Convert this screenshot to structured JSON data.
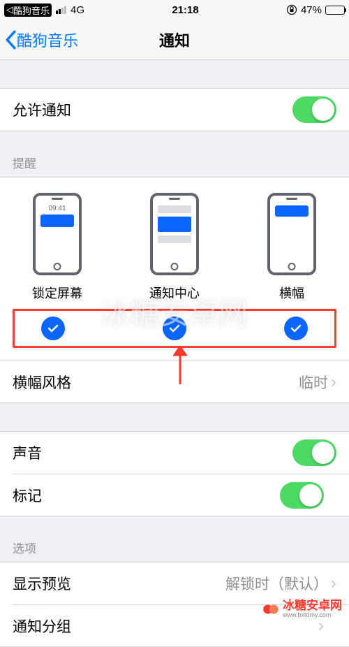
{
  "status": {
    "app_back": "酷狗音乐",
    "carrier_mode": "4G",
    "time": "21:18",
    "battery_pct": "47%"
  },
  "nav": {
    "back": "酷狗音乐",
    "title": "通知"
  },
  "allow": {
    "label": "允许通知",
    "enabled": true
  },
  "alerts": {
    "header": "提醒",
    "lock_label": "锁定屏幕",
    "lock_time": "09:41",
    "center_label": "通知中心",
    "banner_label": "横幅",
    "lock_checked": true,
    "center_checked": true,
    "banner_checked": true
  },
  "banner_style": {
    "label": "横幅风格",
    "value": "临时"
  },
  "sound": {
    "label": "声音",
    "enabled": true
  },
  "badge": {
    "label": "标记",
    "enabled": true
  },
  "options": {
    "header": "选项",
    "preview_label": "显示预览",
    "preview_value": "解锁时（默认）",
    "grouping_label": "通知分组"
  },
  "watermark": "冰糖安卓网",
  "brand": {
    "text": "冰糖安卓网",
    "url": "www.bxtdmy.com"
  }
}
